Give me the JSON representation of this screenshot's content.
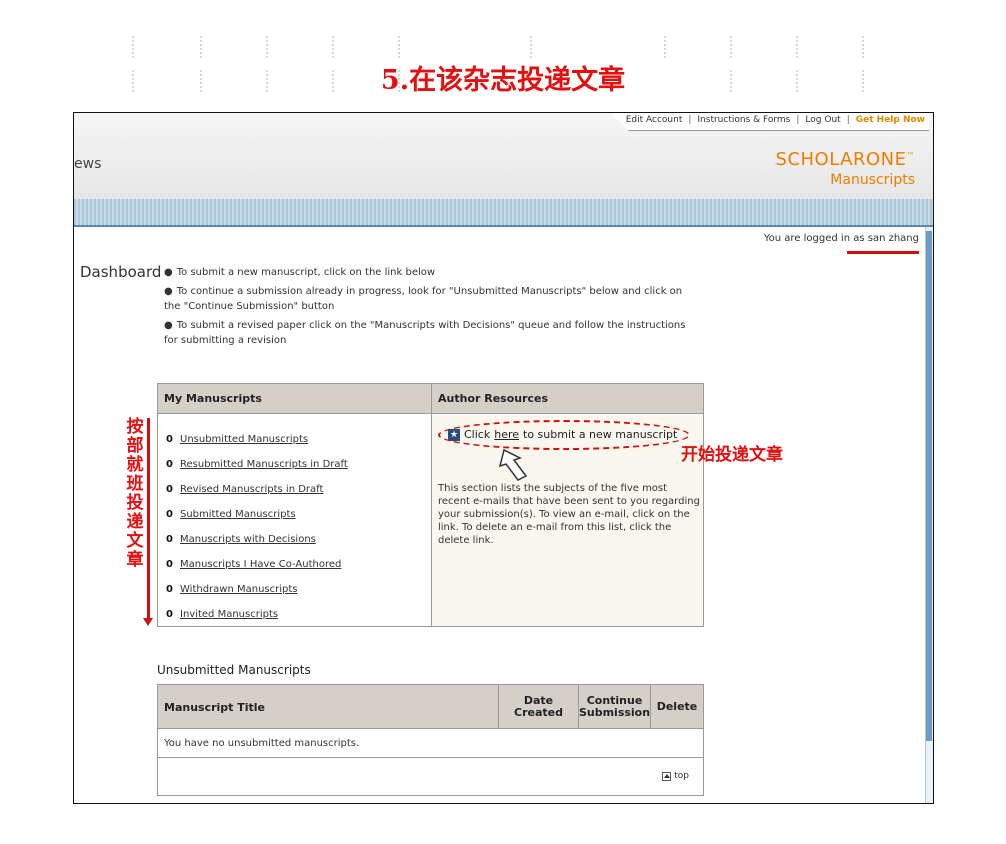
{
  "slide_title": "5.在该杂志投递文章",
  "header": {
    "links": [
      "Edit Account",
      "Instructions & Forms",
      "Log Out"
    ],
    "help": "Get Help Now",
    "site_name": "ews",
    "brand_line1_a": "SCHOLAR",
    "brand_line1_b": "ONE",
    "brand_tm": "™",
    "brand_line2": "Manuscripts"
  },
  "logged_in": "You are logged in as san zhang",
  "dashboard_title": "Dashboard",
  "intro": {
    "b1": "To submit a new manuscript, click on the link below",
    "b2": "To continue a submission already in progress, look for \"Unsubmitted Manuscripts\" below and click on the \"Continue Submission\" button",
    "b3": "To submit a revised paper click on the \"Manuscripts with Decisions\" queue and follow the instructions for submitting a revision"
  },
  "my_manuscripts": {
    "header": "My Manuscripts",
    "items": [
      {
        "count": "0",
        "label": "Unsubmitted Manuscripts"
      },
      {
        "count": "0",
        "label": "Resubmitted Manuscripts in Draft"
      },
      {
        "count": "0",
        "label": "Revised Manuscripts in Draft"
      },
      {
        "count": "0",
        "label": "Submitted Manuscripts"
      },
      {
        "count": "0",
        "label": "Manuscripts with Decisions"
      },
      {
        "count": "0",
        "label": "Manuscripts I Have Co-Authored"
      },
      {
        "count": "0",
        "label": "Withdrawn Manuscripts"
      },
      {
        "count": "0",
        "label": "Invited Manuscripts"
      }
    ]
  },
  "author_resources": {
    "header": "Author Resources",
    "click_pre": "Click",
    "click_link": "here",
    "click_post": "to submit a new manuscript",
    "section_text": "This section lists the subjects of the five most recent e-mails that have been sent to you regarding your submission(s). To view an e-mail, click on the link. To delete an e-mail from this list, click the delete link."
  },
  "annotations": {
    "right": "开始投递文章",
    "left_vertical": [
      "按",
      "部",
      "就",
      "班",
      "投",
      "递",
      "文",
      "章"
    ]
  },
  "unsubmitted": {
    "title": "Unsubmitted Manuscripts",
    "columns": [
      "Manuscript Title",
      "Date Created",
      "Continue Submission",
      "Delete"
    ],
    "empty_text": "You have no unsubmitted manuscripts.",
    "top_link": "top"
  }
}
